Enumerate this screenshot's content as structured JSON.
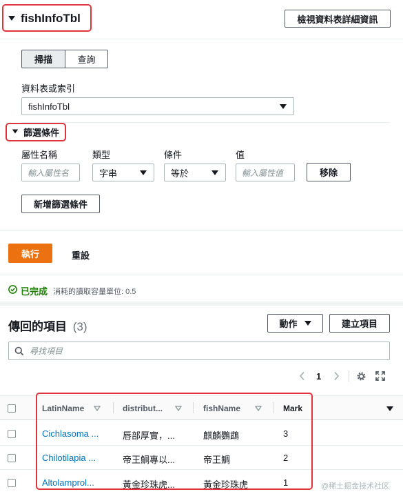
{
  "header": {
    "title": "fishInfoTbl",
    "view_details_label": "檢視資料表詳細資訊"
  },
  "tabs": [
    {
      "label": "掃描",
      "active": true
    },
    {
      "label": "查詢",
      "active": false
    }
  ],
  "table_select": {
    "label": "資料表或索引",
    "value": "fishInfoTbl"
  },
  "filters": {
    "title": "篩選條件",
    "attr_label": "屬性名稱",
    "attr_placeholder": "輸入屬性名",
    "type_label": "類型",
    "type_value": "字串",
    "cond_label": "條件",
    "cond_value": "等於",
    "value_label": "值",
    "value_placeholder": "輸入屬性值",
    "remove_label": "移除",
    "add_label": "新增篩選條件"
  },
  "actions": {
    "run_label": "執行",
    "reset_label": "重設"
  },
  "status": {
    "done_label": "已完成",
    "capacity_text": "消耗的讀取容量單位: 0.5"
  },
  "results": {
    "title": "傳回的項目",
    "count": "(3)",
    "actions_label": "動作",
    "create_label": "建立項目",
    "search_placeholder": "尋找項目",
    "page": "1"
  },
  "table": {
    "columns": [
      "LatinName",
      "distribut...",
      "fishName",
      "Mark"
    ],
    "rows": [
      {
        "latin": "Cichlasoma ...",
        "dist": "唇部厚實，...",
        "name": "麒麟鸚鵡",
        "mark": "3"
      },
      {
        "latin": "Chilotilapia ...",
        "dist": "帝王鯛專以...",
        "name": "帝王鯛",
        "mark": "2"
      },
      {
        "latin": "Altolamprol...",
        "dist": "黃金珍珠虎...",
        "name": "黃金珍珠虎",
        "mark": "1"
      }
    ]
  },
  "watermark": "@稀土掘金技术社区",
  "colors": {
    "accent": "#ec7211",
    "link": "#0073bb",
    "success": "#1d8102",
    "highlight": "#e0333c"
  }
}
